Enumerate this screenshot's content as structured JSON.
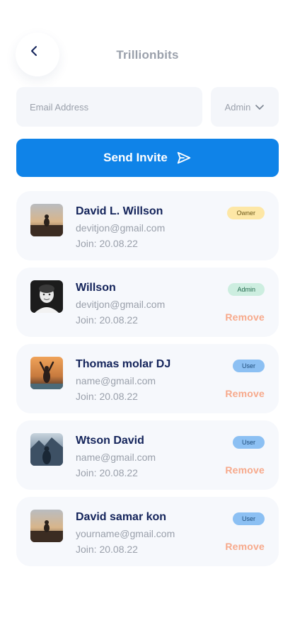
{
  "header": {
    "back_icon": "chevron-left-icon",
    "title": "Trillionbits"
  },
  "invite": {
    "email_placeholder": "Email Address",
    "role_value": "Admin",
    "role_icon": "chevron-down-icon",
    "send_label": "Send Invite",
    "send_icon": "send-icon"
  },
  "colors": {
    "primary": "#0f83e8",
    "title_gray": "#9aa0ab",
    "name_navy": "#13235a",
    "remove_orange": "#f7a98b",
    "badge_owner": "#fde7a6",
    "badge_admin": "#cdeee0",
    "badge_user": "#8cc0f3"
  },
  "members": [
    {
      "name": "David L. Willson",
      "email": "devitjon@gmail.com",
      "join": "Join: 20.08.22",
      "role": "Owner",
      "remove": ""
    },
    {
      "name": "Willson",
      "email": "devitjon@gmail.com",
      "join": "Join: 20.08.22",
      "role": "Admin",
      "remove": "Remove"
    },
    {
      "name": "Thomas molar DJ",
      "email": "name@gmail.com",
      "join": "Join: 20.08.22",
      "role": "User",
      "remove": "Remove"
    },
    {
      "name": "Wtson David",
      "email": "name@gmail.com",
      "join": "Join: 20.08.22",
      "role": "User",
      "remove": "Remove"
    },
    {
      "name": "David samar kon",
      "email": "yourname@gmail.com",
      "join": "Join: 20.08.22",
      "role": "User",
      "remove": "Remove"
    }
  ]
}
